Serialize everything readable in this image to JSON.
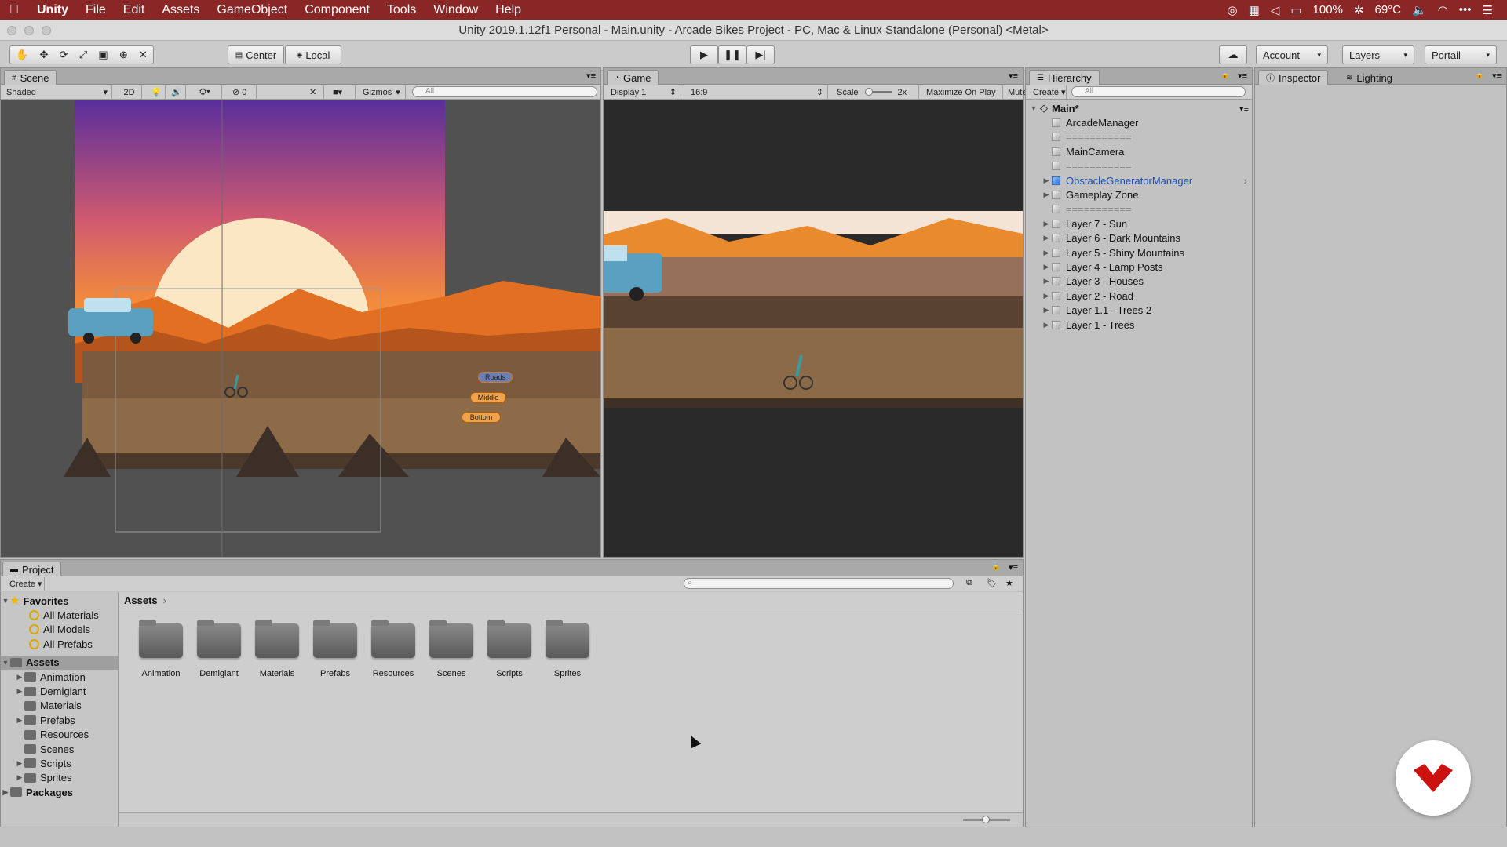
{
  "menubar": {
    "items": [
      "Unity",
      "File",
      "Edit",
      "Assets",
      "GameObject",
      "Component",
      "Tools",
      "Window",
      "Help"
    ],
    "status": {
      "battery": "100%",
      "temperature": "69°C"
    }
  },
  "window_title": "Unity 2019.1.12f1 Personal - Main.unity - Arcade Bikes Project - PC, Mac & Linux Standalone (Personal) <Metal>",
  "toolbar": {
    "pivot_label": "Center",
    "space_label": "Local",
    "account_label": "Account",
    "layers_label": "Layers",
    "layout_label": "Portail"
  },
  "scene": {
    "tab": "Scene",
    "shading": "Shaded",
    "mode_2d": "2D",
    "effects_count": "0",
    "gizmos": "Gizmos",
    "search_placeholder": "All",
    "lane_labels": [
      "Roads",
      "Middle",
      "Bottom"
    ]
  },
  "game": {
    "tab": "Game",
    "display": "Display 1",
    "aspect": "16:9",
    "scale_label": "Scale",
    "scale_value": "2x",
    "maximize": "Maximize On Play",
    "mute": "Mute"
  },
  "hierarchy": {
    "tab": "Hierarchy",
    "create": "Create",
    "search_placeholder": "All",
    "scene_name": "Main*",
    "items": [
      {
        "label": "ArcadeManager",
        "expandable": false,
        "highlight": false
      },
      {
        "label": "===========",
        "expandable": false,
        "highlight": false
      },
      {
        "label": "MainCamera",
        "expandable": false,
        "highlight": false
      },
      {
        "label": "===========",
        "expandable": false,
        "highlight": false
      },
      {
        "label": "ObstacleGeneratorManager",
        "expandable": true,
        "highlight": true
      },
      {
        "label": "Gameplay Zone",
        "expandable": true,
        "highlight": false
      },
      {
        "label": "===========",
        "expandable": false,
        "highlight": false
      },
      {
        "label": "Layer 7 - Sun",
        "expandable": true,
        "highlight": false
      },
      {
        "label": "Layer 6 - Dark Mountains",
        "expandable": true,
        "highlight": false
      },
      {
        "label": "Layer 5 - Shiny Mountains",
        "expandable": true,
        "highlight": false
      },
      {
        "label": "Layer 4 - Lamp Posts",
        "expandable": true,
        "highlight": false
      },
      {
        "label": "Layer 3 - Houses",
        "expandable": true,
        "highlight": false
      },
      {
        "label": "Layer 2 - Road",
        "expandable": true,
        "highlight": false
      },
      {
        "label": "Layer 1.1 - Trees 2",
        "expandable": true,
        "highlight": false
      },
      {
        "label": "Layer 1 - Trees",
        "expandable": true,
        "highlight": false
      }
    ]
  },
  "inspector": {
    "tab": "Inspector",
    "lighting_tab": "Lighting"
  },
  "project": {
    "tab": "Project",
    "create": "Create",
    "breadcrumb": "Assets",
    "favorites_label": "Favorites",
    "favorites": [
      "All Materials",
      "All Models",
      "All Prefabs"
    ],
    "assets_label": "Assets",
    "tree": [
      {
        "label": "Animation",
        "expandable": true
      },
      {
        "label": "Demigiant",
        "expandable": true
      },
      {
        "label": "Materials",
        "expandable": false
      },
      {
        "label": "Prefabs",
        "expandable": true
      },
      {
        "label": "Resources",
        "expandable": false
      },
      {
        "label": "Scenes",
        "expandable": false
      },
      {
        "label": "Scripts",
        "expandable": true
      },
      {
        "label": "Sprites",
        "expandable": true
      }
    ],
    "packages_label": "Packages",
    "folders": [
      "Animation",
      "Demigiant",
      "Materials",
      "Prefabs",
      "Resources",
      "Scenes",
      "Scripts",
      "Sprites"
    ]
  },
  "colors": {
    "menubar": "#8a2626",
    "selection": "#3a72d8",
    "accent_logo": "#cc1111"
  }
}
